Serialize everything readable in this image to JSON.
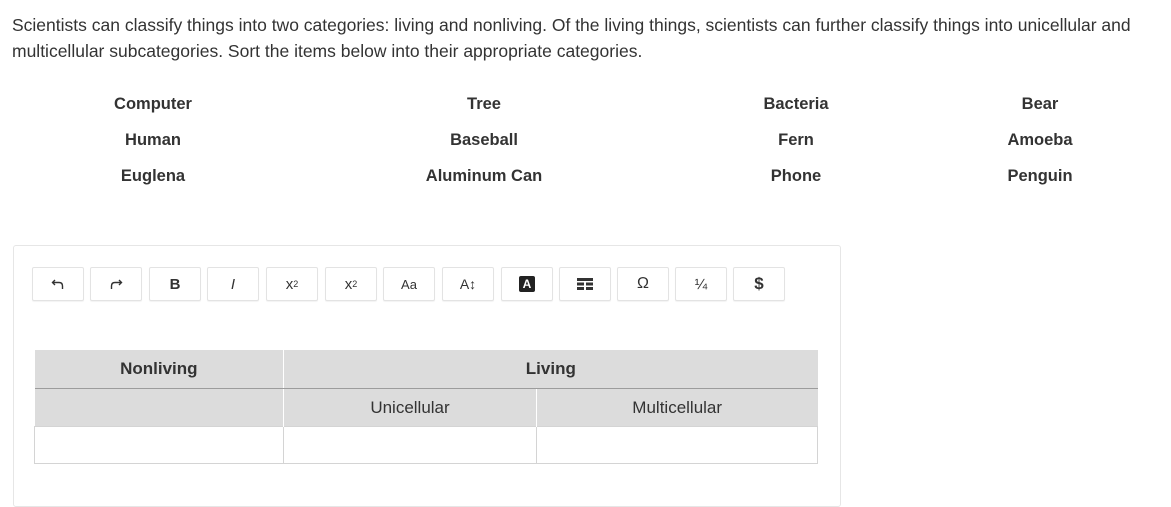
{
  "prompt": "Scientists can classify things into two categories: living and nonliving. Of the living things, scientists can further classify things into unicellular and multicellular subcategories. Sort the items below into their appropriate categories.",
  "items": [
    [
      "Computer",
      "Tree",
      "Bacteria",
      "Bear"
    ],
    [
      "Human",
      "Baseball",
      "Fern",
      "Amoeba"
    ],
    [
      "Euglena",
      "Aluminum Can",
      "Phone",
      "Penguin"
    ]
  ],
  "toolbar": {
    "bold": "B",
    "italic": "I",
    "superscript_base": "x",
    "superscript_mark": "2",
    "subscript_base": "x",
    "subscript_mark": "2",
    "font_case": "Aa",
    "font_size": "A↕",
    "font_color": "A",
    "special_chars": "Ω",
    "fraction": "¼",
    "currency": "$"
  },
  "table": {
    "nonliving": "Nonliving",
    "living": "Living",
    "unicellular": "Unicellular",
    "multicellular": "Multicellular"
  }
}
